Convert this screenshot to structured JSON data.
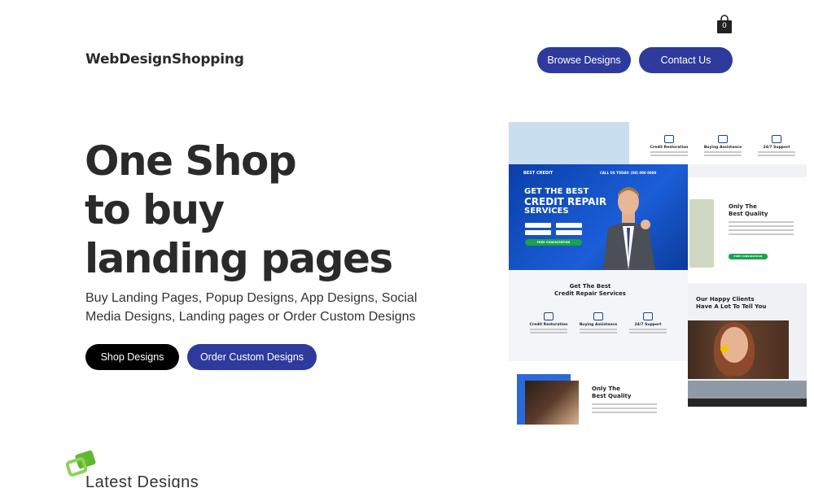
{
  "brand": {
    "name": "WebDesignShopping"
  },
  "cart": {
    "count": "0"
  },
  "nav": {
    "browse_label": "Browse Designs",
    "contact_label": "Contact Us"
  },
  "hero": {
    "title_lines": [
      "One Shop",
      "to buy",
      "landing pages"
    ],
    "subtitle": "Buy Landing Pages, Popup Designs, App Designs, Social Media Designs, Landing pages or Order Custom Designs",
    "shop_label": "Shop Designs",
    "order_label": "Order Custom Designs"
  },
  "preview": {
    "logo": "BEST CREDIT",
    "call": "CALL US TODAY: (00) 000 0000",
    "headline_1": "GET THE BEST",
    "headline_2": "CREDIT REPAIR",
    "headline_3": "SERVICES",
    "cta": "FREE CONSULTATION",
    "features": [
      "Credit Restoration",
      "Buying Assistance",
      "24/7 Support"
    ],
    "quality_1": "Only The",
    "quality_2": "Best Quality",
    "services_1": "Get The Best",
    "services_2": "Credit Repair Services",
    "clients_1": "Our Happy Clients",
    "clients_2": "Have A Lot To Tell You"
  },
  "latest": {
    "title": "Latest Designs"
  },
  "colors": {
    "accent": "#2e3a9c",
    "dark_button": "#000000",
    "cta_green": "#1ba24a",
    "banner_blue": "#1b5ed8"
  }
}
